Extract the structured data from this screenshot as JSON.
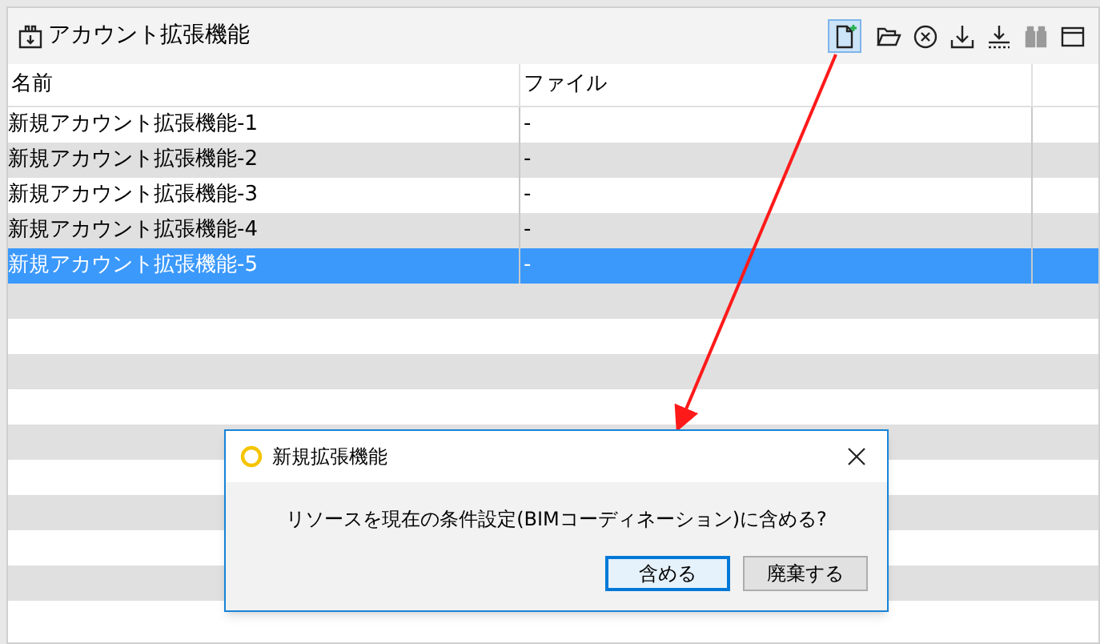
{
  "panel": {
    "title": "アカウント拡張機能"
  },
  "toolbar": [
    {
      "kind": "new-file",
      "highlighted": true,
      "disabled": false
    },
    {
      "kind": "folder",
      "highlighted": false,
      "disabled": false
    },
    {
      "kind": "cancel",
      "highlighted": false,
      "disabled": false
    },
    {
      "kind": "download",
      "highlighted": false,
      "disabled": false
    },
    {
      "kind": "download-dots",
      "highlighted": false,
      "disabled": false
    },
    {
      "kind": "binoculars",
      "highlighted": false,
      "disabled": true
    },
    {
      "kind": "window",
      "highlighted": false,
      "disabled": false
    }
  ],
  "table": {
    "columns": [
      "名前",
      "ファイル"
    ],
    "rows": [
      {
        "name": "新規アカウント拡張機能-1",
        "file": "-",
        "selected": false
      },
      {
        "name": "新規アカウント拡張機能-2",
        "file": "-",
        "selected": false
      },
      {
        "name": "新規アカウント拡張機能-3",
        "file": "-",
        "selected": false
      },
      {
        "name": "新規アカウント拡張機能-4",
        "file": "-",
        "selected": false
      },
      {
        "name": "新規アカウント拡張機能-5",
        "file": "-",
        "selected": true
      }
    ]
  },
  "dialog": {
    "title": "新規拡張機能",
    "message": "リソースを現在の条件設定(BIMコーディネーション)に含める?",
    "buttons": [
      {
        "label": "含める",
        "default": true
      },
      {
        "label": "廃棄する",
        "default": false
      }
    ]
  }
}
